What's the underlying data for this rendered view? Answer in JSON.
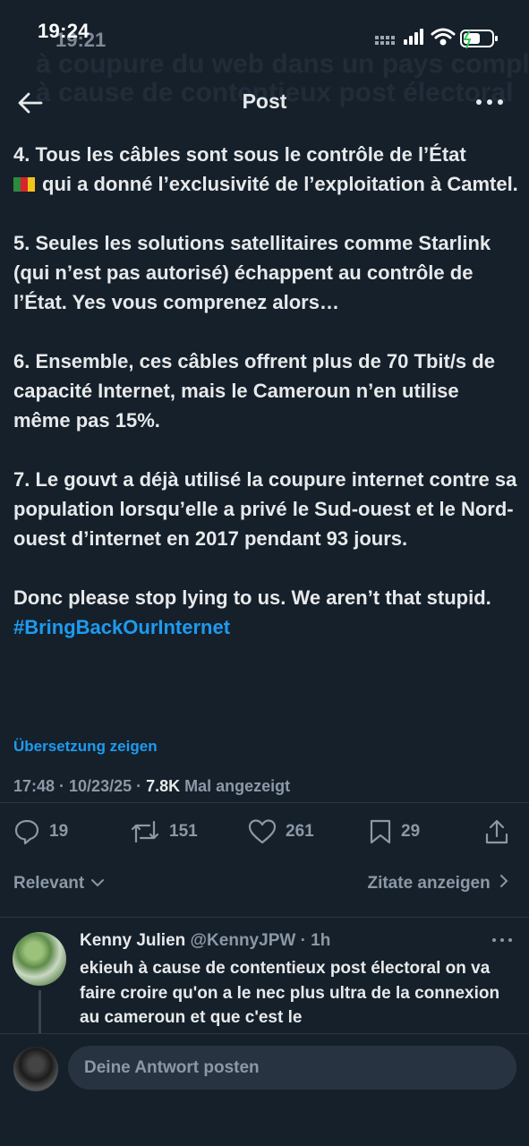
{
  "status_bar": {
    "time": "19:24",
    "ghost_time": "19:21",
    "ghost_text_lines": [
      "à coupure du web dans un pays complet",
      "à cause de contentieux post électoral"
    ]
  },
  "header": {
    "title": "Post"
  },
  "post": {
    "para4_a": "4. Tous les câbles sont sous le contrôle de l’État",
    "para4_b": "qui a donné l’exclusivité de l’exploitation à Camtel.",
    "para5": "5. Seules les solutions satellitaires comme Starlink (qui n’est pas autorisé) échappent au contrôle de l’État. Yes vous comprenez alors…",
    "para6": "6. Ensemble, ces câbles offrent plus de 70 Tbit/s de capacité Internet, mais le Cameroun n’en utilise même pas 15%.",
    "para7": "7. Le gouvt a déjà utilisé la coupure internet contre sa population lorsqu’elle a privé le Sud-ouest et le Nord-ouest d’internet en 2017 pendant 93 jours.",
    "para8": "Donc please stop lying to us. We aren’t that stupid.",
    "hashtag": "#BringBackOurInternet",
    "translate_label": "Übersetzung zeigen",
    "timestamp": "17:48 · 10/23/25 · ",
    "views": "7.8K",
    "views_label": " Mal angezeigt"
  },
  "actions": {
    "replies": "19",
    "reposts": "151",
    "likes": "261",
    "bookmarks": "29"
  },
  "sort": {
    "relevant": "Relevant",
    "quotes": "Zitate anzeigen"
  },
  "reply": {
    "name": "Kenny Julien",
    "handle": "@KennyJPW · 1h",
    "text": "ekieuh à cause de contentieux post électoral on va faire croire qu'on a le nec plus ultra de la connexion au cameroun et que c'est le"
  },
  "composer": {
    "placeholder": "Deine Antwort posten"
  },
  "colors": {
    "background": "#15202b",
    "accent": "#1d9bf0",
    "text_primary": "#e7e9ea",
    "text_secondary": "#8b98a5"
  }
}
